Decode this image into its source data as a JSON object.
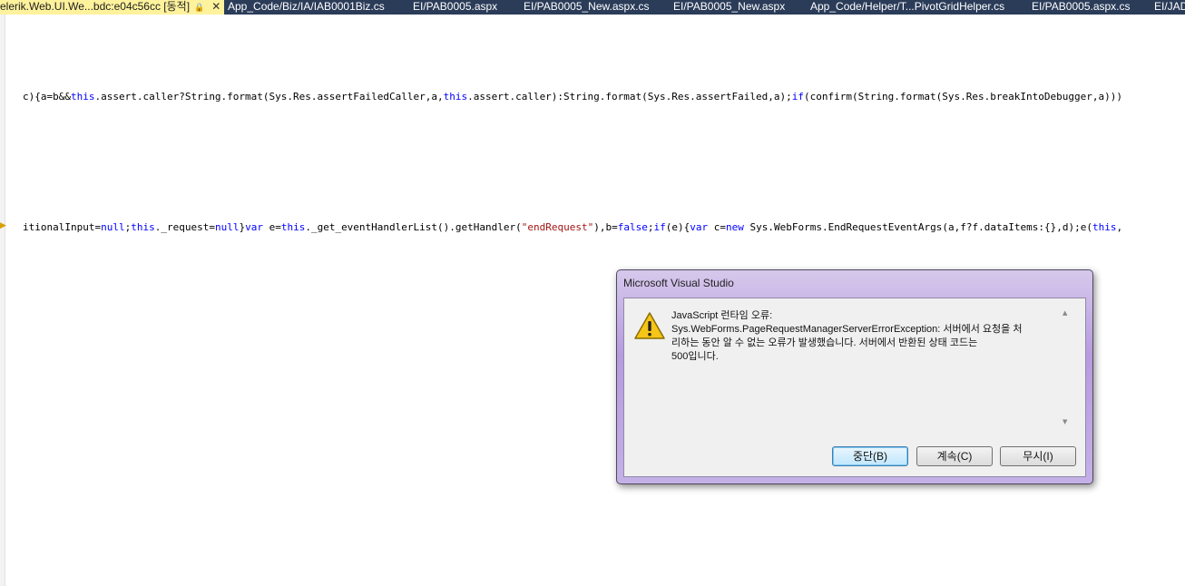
{
  "tabs": [
    {
      "label": "elerik.Web.UI.We...bdc:e04c56cc [동적]",
      "active": true
    },
    {
      "label": "App_Code/Biz/IA/IAB0001Biz.cs"
    },
    {
      "label": "EI/PAB0005.aspx"
    },
    {
      "label": "EI/PAB0005_New.aspx.cs"
    },
    {
      "label": "EI/PAB0005_New.aspx"
    },
    {
      "label": "App_Code/Helper/T...PivotGridHelper.cs"
    },
    {
      "label": "EI/PAB0005.aspx.cs"
    },
    {
      "label": "EI/JAD"
    }
  ],
  "editor": {
    "line1": [
      {
        "t": "c){a=b&&",
        "c": ""
      },
      {
        "t": "this",
        "c": "kw"
      },
      {
        "t": ".assert.caller?String.format(Sys.Res.assertFailedCaller,a,",
        "c": ""
      },
      {
        "t": "this",
        "c": "kw"
      },
      {
        "t": ".assert.caller):String.format(Sys.Res.assertFailed,a);",
        "c": ""
      },
      {
        "t": "if",
        "c": "kw"
      },
      {
        "t": "(confirm(String.format(Sys.Res.breakIntoDebugger,a)))",
        "c": ""
      }
    ],
    "line2": [
      {
        "t": "itionalInput=",
        "c": ""
      },
      {
        "t": "null",
        "c": "kw"
      },
      {
        "t": ";",
        "c": ""
      },
      {
        "t": "this",
        "c": "kw"
      },
      {
        "t": "._request=",
        "c": ""
      },
      {
        "t": "null",
        "c": "kw"
      },
      {
        "t": "}",
        "c": ""
      },
      {
        "t": "var",
        "c": "kw"
      },
      {
        "t": " e=",
        "c": ""
      },
      {
        "t": "this",
        "c": "kw"
      },
      {
        "t": "._get_eventHandlerList().getHandler(",
        "c": ""
      },
      {
        "t": "\"endRequest\"",
        "c": "str"
      },
      {
        "t": "),b=",
        "c": ""
      },
      {
        "t": "false",
        "c": "kw"
      },
      {
        "t": ";",
        "c": ""
      },
      {
        "t": "if",
        "c": "kw"
      },
      {
        "t": "(e){",
        "c": ""
      },
      {
        "t": "var",
        "c": "kw"
      },
      {
        "t": " c=",
        "c": ""
      },
      {
        "t": "new",
        "c": "kw"
      },
      {
        "t": " Sys.WebForms.EndRequestEventArgs(a,f?f.dataItems:{},d);e(",
        "c": ""
      },
      {
        "t": "this",
        "c": "kw"
      },
      {
        "t": ",",
        "c": ""
      }
    ]
  },
  "dialog": {
    "title": "Microsoft Visual Studio",
    "message_lines": [
      "JavaScript 런타임 오류:",
      "Sys.WebForms.PageRequestManagerServerErrorException: 서버에서 요청을 처",
      "리하는 동안 알 수 없는 오류가 발생했습니다. 서버에서 반환된 상태 코드는",
      "500입니다."
    ],
    "buttons": {
      "break": "중단(B)",
      "continue": "계속(C)",
      "ignore": "무시(I)"
    }
  },
  "icons": {
    "warning": "warning-icon",
    "lock": "lock-icon",
    "close": "close-icon"
  }
}
